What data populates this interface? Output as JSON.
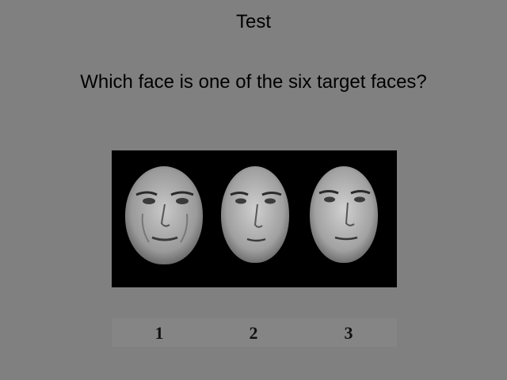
{
  "header": {
    "title": "Test"
  },
  "prompt": {
    "question": "Which face is one of the six target faces?"
  },
  "stimulus": {
    "background": "#000000",
    "faces": [
      {
        "id": 1,
        "icon": "face-portrait"
      },
      {
        "id": 2,
        "icon": "face-portrait"
      },
      {
        "id": 3,
        "icon": "face-portrait"
      }
    ]
  },
  "choices": {
    "labels": [
      "1",
      "2",
      "3"
    ]
  }
}
